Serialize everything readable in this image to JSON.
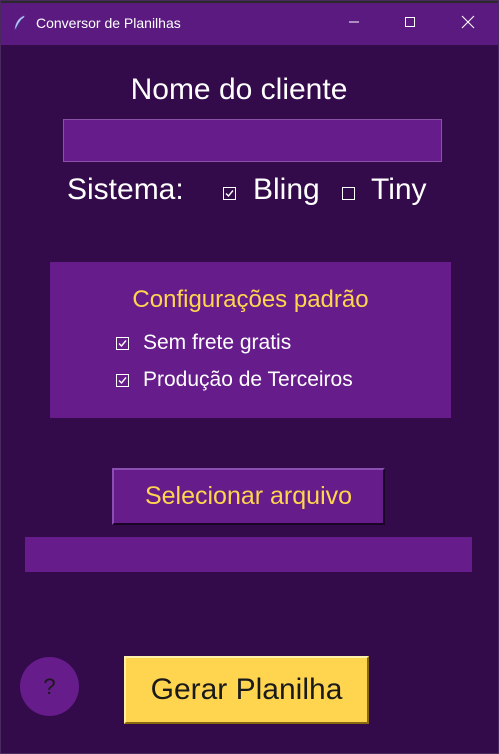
{
  "window": {
    "title": "Conversor de Planilhas",
    "app_icon": "feather-icon",
    "controls": [
      "minimize-icon",
      "maximize-icon",
      "close-icon"
    ]
  },
  "form": {
    "cliente_label": "Nome do cliente",
    "cliente_value": "",
    "sistema_label": "Sistema:",
    "sistema_options": [
      {
        "label": "Bling",
        "checked": true
      },
      {
        "label": "Tiny",
        "checked": false
      }
    ]
  },
  "config": {
    "title": "Configurações padrão",
    "options": [
      {
        "label": "Sem frete gratis",
        "checked": true
      },
      {
        "label": "Produção de Terceiros",
        "checked": true
      }
    ]
  },
  "file": {
    "select_label": "Selecionar arquivo",
    "selected_path": ""
  },
  "actions": {
    "help_label": "?",
    "generate_label": "Gerar Planilha"
  },
  "colors": {
    "background": "#330a4a",
    "titlebar": "#5b1a80",
    "panel": "#661c8a",
    "accent": "#ffd54f",
    "text": "#ffffff"
  }
}
